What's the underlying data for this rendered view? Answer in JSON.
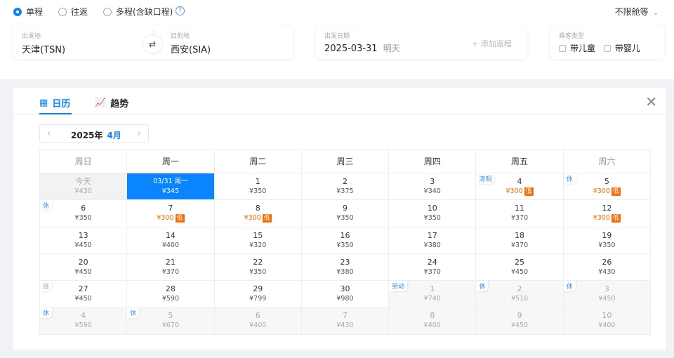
{
  "trip_types": [
    {
      "label": "单程",
      "selected": true
    },
    {
      "label": "往返",
      "selected": false
    },
    {
      "label": "多程(含缺口程)",
      "selected": false
    }
  ],
  "help_icon": "?",
  "cabin": "不限舱等",
  "from": {
    "label": "出发地",
    "value": "天津(TSN)"
  },
  "to": {
    "label": "目的地",
    "value": "西安(SIA)"
  },
  "date": {
    "label": "出发日期",
    "value": "2025-03-31",
    "hint": "明天",
    "add_return": "+ 添加返程"
  },
  "passenger": {
    "label": "乘客类型",
    "child": "带儿童",
    "infant": "带婴儿"
  },
  "tabs": [
    {
      "label": "日历"
    },
    {
      "label": "趋势"
    }
  ],
  "month": {
    "year": "2025年",
    "month": "4月"
  },
  "weekdays": [
    "周日",
    "周一",
    "周二",
    "周三",
    "周四",
    "周五",
    "周六"
  ],
  "weeks": [
    [
      {
        "d": "今天",
        "p": "¥430",
        "s": "past"
      },
      {
        "d": "03/31 周一",
        "p": "¥345",
        "s": "sel"
      },
      {
        "d": "1",
        "p": "¥350"
      },
      {
        "d": "2",
        "p": "¥375"
      },
      {
        "d": "3",
        "p": "¥340"
      },
      {
        "d": "4",
        "p": "¥300",
        "low": "低",
        "tag": "清明"
      },
      {
        "d": "5",
        "p": "¥300",
        "low": "低",
        "tag": "休"
      }
    ],
    [
      {
        "d": "6",
        "p": "¥350",
        "tag": "休"
      },
      {
        "d": "7",
        "p": "¥300",
        "low": "低"
      },
      {
        "d": "8",
        "p": "¥300",
        "low": "低"
      },
      {
        "d": "9",
        "p": "¥350"
      },
      {
        "d": "10",
        "p": "¥350"
      },
      {
        "d": "11",
        "p": "¥370"
      },
      {
        "d": "12",
        "p": "¥300",
        "low": "低"
      }
    ],
    [
      {
        "d": "13",
        "p": "¥450"
      },
      {
        "d": "14",
        "p": "¥400"
      },
      {
        "d": "15",
        "p": "¥320"
      },
      {
        "d": "16",
        "p": "¥350"
      },
      {
        "d": "17",
        "p": "¥380"
      },
      {
        "d": "18",
        "p": "¥370"
      },
      {
        "d": "19",
        "p": "¥350"
      }
    ],
    [
      {
        "d": "20",
        "p": "¥450"
      },
      {
        "d": "21",
        "p": "¥370"
      },
      {
        "d": "22",
        "p": "¥350"
      },
      {
        "d": "23",
        "p": "¥380"
      },
      {
        "d": "24",
        "p": "¥370"
      },
      {
        "d": "25",
        "p": "¥450"
      },
      {
        "d": "26",
        "p": "¥430"
      }
    ],
    [
      {
        "d": "27",
        "p": "¥450",
        "tag": "班"
      },
      {
        "d": "28",
        "p": "¥590"
      },
      {
        "d": "29",
        "p": "¥799"
      },
      {
        "d": "30",
        "p": "¥980"
      },
      {
        "d": "1",
        "p": "¥740",
        "s": "other",
        "tag": "劳动"
      },
      {
        "d": "2",
        "p": "¥510",
        "s": "other",
        "tag": "休"
      },
      {
        "d": "3",
        "p": "¥450",
        "s": "other",
        "tag": "休"
      }
    ],
    [
      {
        "d": "4",
        "p": "¥590",
        "s": "other",
        "tag": "休"
      },
      {
        "d": "5",
        "p": "¥670",
        "s": "other",
        "tag": "休"
      },
      {
        "d": "6",
        "p": "¥400",
        "s": "other"
      },
      {
        "d": "7",
        "p": "¥430",
        "s": "other"
      },
      {
        "d": "8",
        "p": "¥400",
        "s": "other"
      },
      {
        "d": "9",
        "p": "¥450",
        "s": "other"
      },
      {
        "d": "10",
        "p": "¥400",
        "s": "other"
      }
    ]
  ]
}
